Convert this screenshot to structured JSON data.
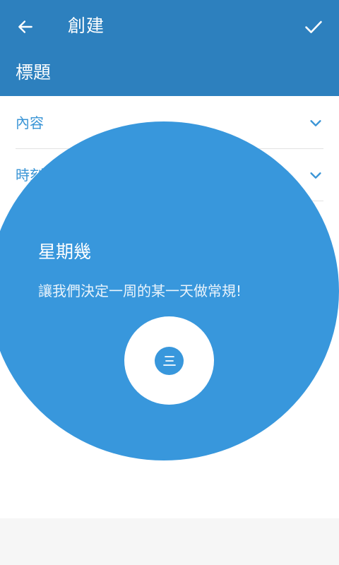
{
  "appbar": {
    "title": "創建",
    "back_icon": "arrow-left-icon",
    "confirm_icon": "check-icon",
    "background": "#2d80be"
  },
  "form": {
    "title_value": "標題",
    "rows": [
      {
        "label": "內容",
        "icon": "chevron-down-icon"
      },
      {
        "label": "時刻",
        "icon": "chevron-down-icon"
      }
    ],
    "accent": "#3a95d6"
  },
  "showcase": {
    "title": "星期幾",
    "description": "讓我們決定一周的某一天做常規!",
    "target_icon": "menu-lines-icon",
    "color": "#3897dc"
  }
}
